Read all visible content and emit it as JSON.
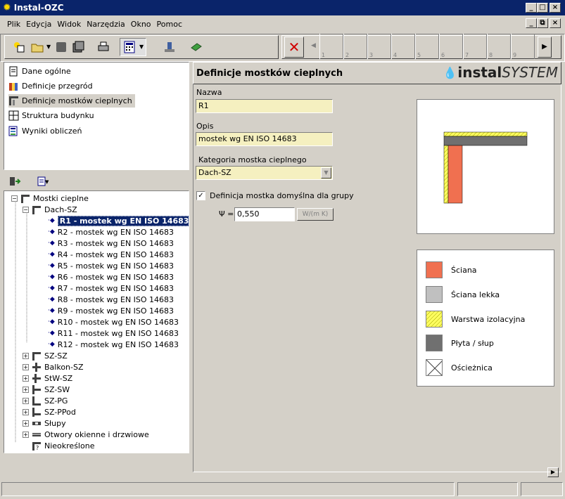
{
  "window": {
    "title": "Instal-OZC"
  },
  "menu": [
    "Plik",
    "Edycja",
    "Widok",
    "Narzędzia",
    "Okno",
    "Pomoc"
  ],
  "pages": [
    "1",
    "2",
    "3",
    "4",
    "5",
    "6",
    "7",
    "8",
    "9"
  ],
  "nav": [
    {
      "label": "Dane ogólne",
      "icon": "document-icon"
    },
    {
      "label": "Definicje przegród",
      "icon": "wall-icon"
    },
    {
      "label": "Definicje mostków cieplnych",
      "icon": "bridge-icon"
    },
    {
      "label": "Struktura budynku",
      "icon": "structure-icon"
    },
    {
      "label": "Wyniki obliczeń",
      "icon": "results-icon"
    }
  ],
  "tree": {
    "root": "Mostki cieplne",
    "group": "Dach-SZ",
    "items": [
      "R1 - mostek wg EN ISO 14683",
      "R2 - mostek wg EN ISO 14683",
      "R3 - mostek wg EN ISO 14683",
      "R4 - mostek wg EN ISO 14683",
      "R5 - mostek wg EN ISO 14683",
      "R6 - mostek wg EN ISO 14683",
      "R7 - mostek wg EN ISO 14683",
      "R8 - mostek wg EN ISO 14683",
      "R9 - mostek wg EN ISO 14683",
      "R10 - mostek wg EN ISO 14683",
      "R11 - mostek wg EN ISO 14683",
      "R12 - mostek wg EN ISO 14683"
    ],
    "groups": [
      "SZ-SZ",
      "Balkon-SZ",
      "StW-SZ",
      "SZ-SW",
      "SZ-PG",
      "SZ-PPod",
      "Słupy",
      "Otwory okienne i drzwiowe"
    ],
    "last": "Nieokreślone"
  },
  "header": {
    "title": "Definicje mostków cieplnych",
    "logo_a": "instal",
    "logo_b": "SYSTEM"
  },
  "form": {
    "nazwa_label": "Nazwa",
    "nazwa_value": "R1",
    "opis_label": "Opis",
    "opis_value": "mostek wg EN ISO 14683",
    "kategoria_label": "Kategoria mostka cieplnego",
    "kategoria_value": "Dach-SZ",
    "checkbox_label": "Definicja mostka domyślna dla grupy",
    "psi_label": "Ψ =",
    "psi_value": "0,550",
    "unit": "W/(m K)"
  },
  "legend": [
    {
      "label": "Ściana",
      "color": "#f07050"
    },
    {
      "label": "Ściana lekka",
      "color": "#c0c0c0"
    },
    {
      "label": "Warstwa izolacyjna",
      "color": "#ffff60"
    },
    {
      "label": "Płyta / słup",
      "color": "#707070"
    },
    {
      "label": "Ościeżnica",
      "color": "#ffffff"
    }
  ],
  "colors": {
    "title_bar": "#0a246a",
    "field_bg": "#f5f0c0",
    "selection": "#0a246a"
  }
}
